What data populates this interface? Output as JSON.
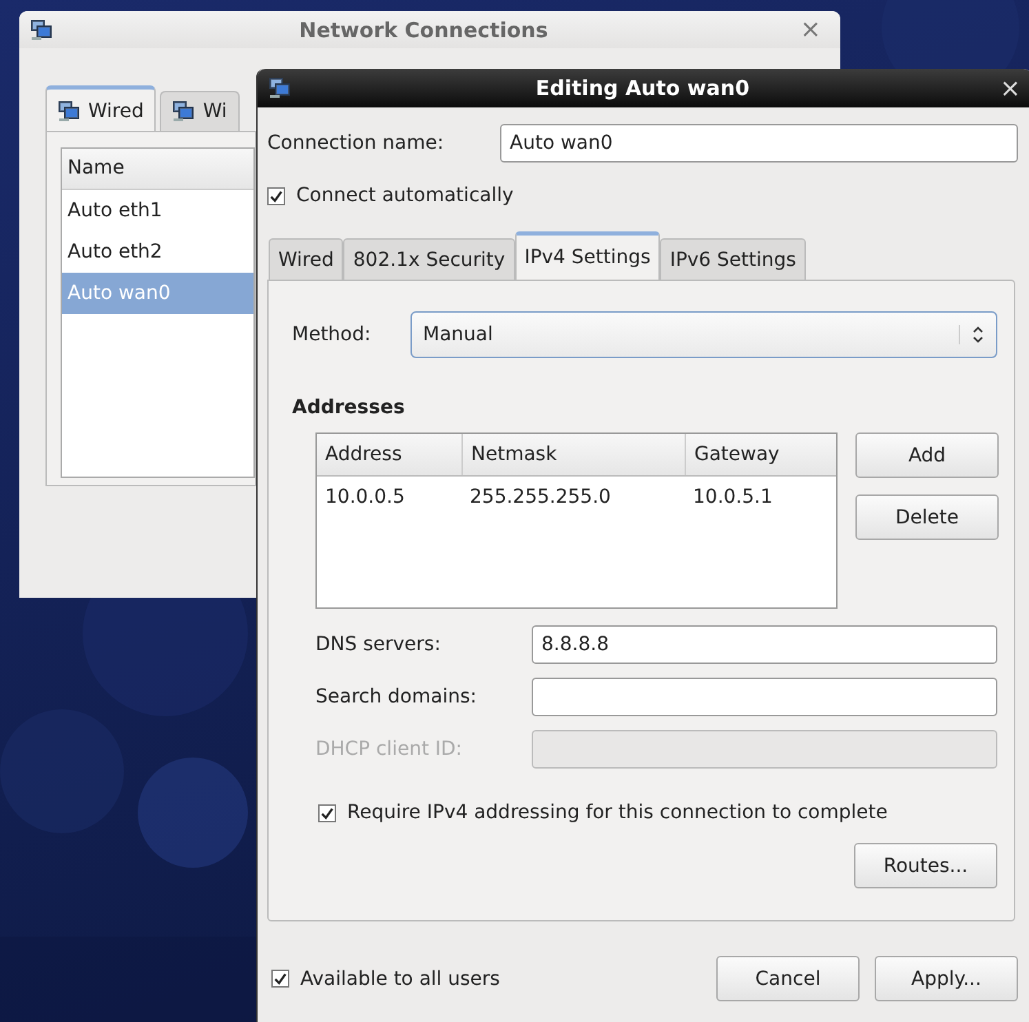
{
  "network_connections": {
    "title": "Network Connections",
    "close": "×",
    "tabs": [
      {
        "label": "Wired",
        "selected": true
      },
      {
        "label": "Wi",
        "selected": false
      }
    ],
    "list": {
      "column": "Name",
      "rows": [
        {
          "label": "Auto eth1",
          "selected": false
        },
        {
          "label": "Auto eth2",
          "selected": false
        },
        {
          "label": "Auto wan0",
          "selected": true
        }
      ]
    }
  },
  "editor": {
    "title": "Editing Auto wan0",
    "close": "×",
    "connection_name": {
      "label": "Connection name:",
      "value": "Auto wan0"
    },
    "connect_automatically": {
      "label": "Connect automatically",
      "checked": true
    },
    "tabs": [
      {
        "label": "Wired",
        "selected": false
      },
      {
        "label": "802.1x Security",
        "selected": false
      },
      {
        "label": "IPv4 Settings",
        "selected": true
      },
      {
        "label": "IPv6 Settings",
        "selected": false
      }
    ],
    "method": {
      "label": "Method:",
      "value": "Manual"
    },
    "addresses": {
      "heading": "Addresses",
      "columns": [
        "Address",
        "Netmask",
        "Gateway"
      ],
      "rows": [
        [
          "10.0.0.5",
          "255.255.255.0",
          "10.0.5.1"
        ]
      ],
      "buttons": [
        "Add",
        "Delete"
      ]
    },
    "fields": [
      {
        "label": "DNS servers:",
        "value": "8.8.8.8",
        "disabled": false
      },
      {
        "label": "Search domains:",
        "disabled": false
      },
      {
        "label": "DHCP client ID:",
        "disabled": true
      }
    ],
    "require_ipv4": {
      "label": "Require IPv4 addressing for this connection to complete",
      "checked": true
    },
    "routes_button": "Routes...",
    "available_to_all": {
      "label": "Available to all users",
      "checked": true
    },
    "buttons": [
      "Cancel",
      "Apply..."
    ]
  }
}
